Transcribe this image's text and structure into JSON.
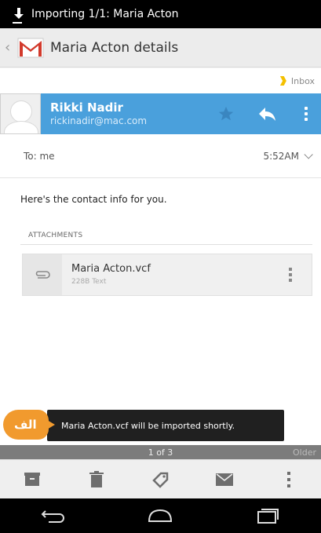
{
  "status_bar": {
    "notification": "Importing 1/1: Maria Acton"
  },
  "action_bar": {
    "title": "Maria Acton details"
  },
  "message": {
    "label": "Inbox",
    "sender_name": "Rikki Nadir",
    "sender_email": "rickinadir@mac.com",
    "to": "To: me",
    "time": "5:52AM",
    "body": "Here's the contact info for you.",
    "attachments_header": "ATTACHMENTS",
    "attachment": {
      "name": "Maria Acton.vcf",
      "meta": "228B Text"
    }
  },
  "toast": {
    "text": "Maria Acton.vcf will be imported shortly."
  },
  "badge": {
    "text": "الف"
  },
  "pager": {
    "position": "1 of 3",
    "older": "Older"
  },
  "colors": {
    "sender_bar": "#4aa0dc",
    "badge": "#f19a2e",
    "inbox_tag": "#f4c000"
  },
  "icons": {
    "toolbar": [
      "archive-icon",
      "delete-icon",
      "label-icon",
      "mark-unread-icon",
      "overflow-icon"
    ],
    "nav": [
      "back-icon",
      "home-icon",
      "recents-icon"
    ]
  }
}
